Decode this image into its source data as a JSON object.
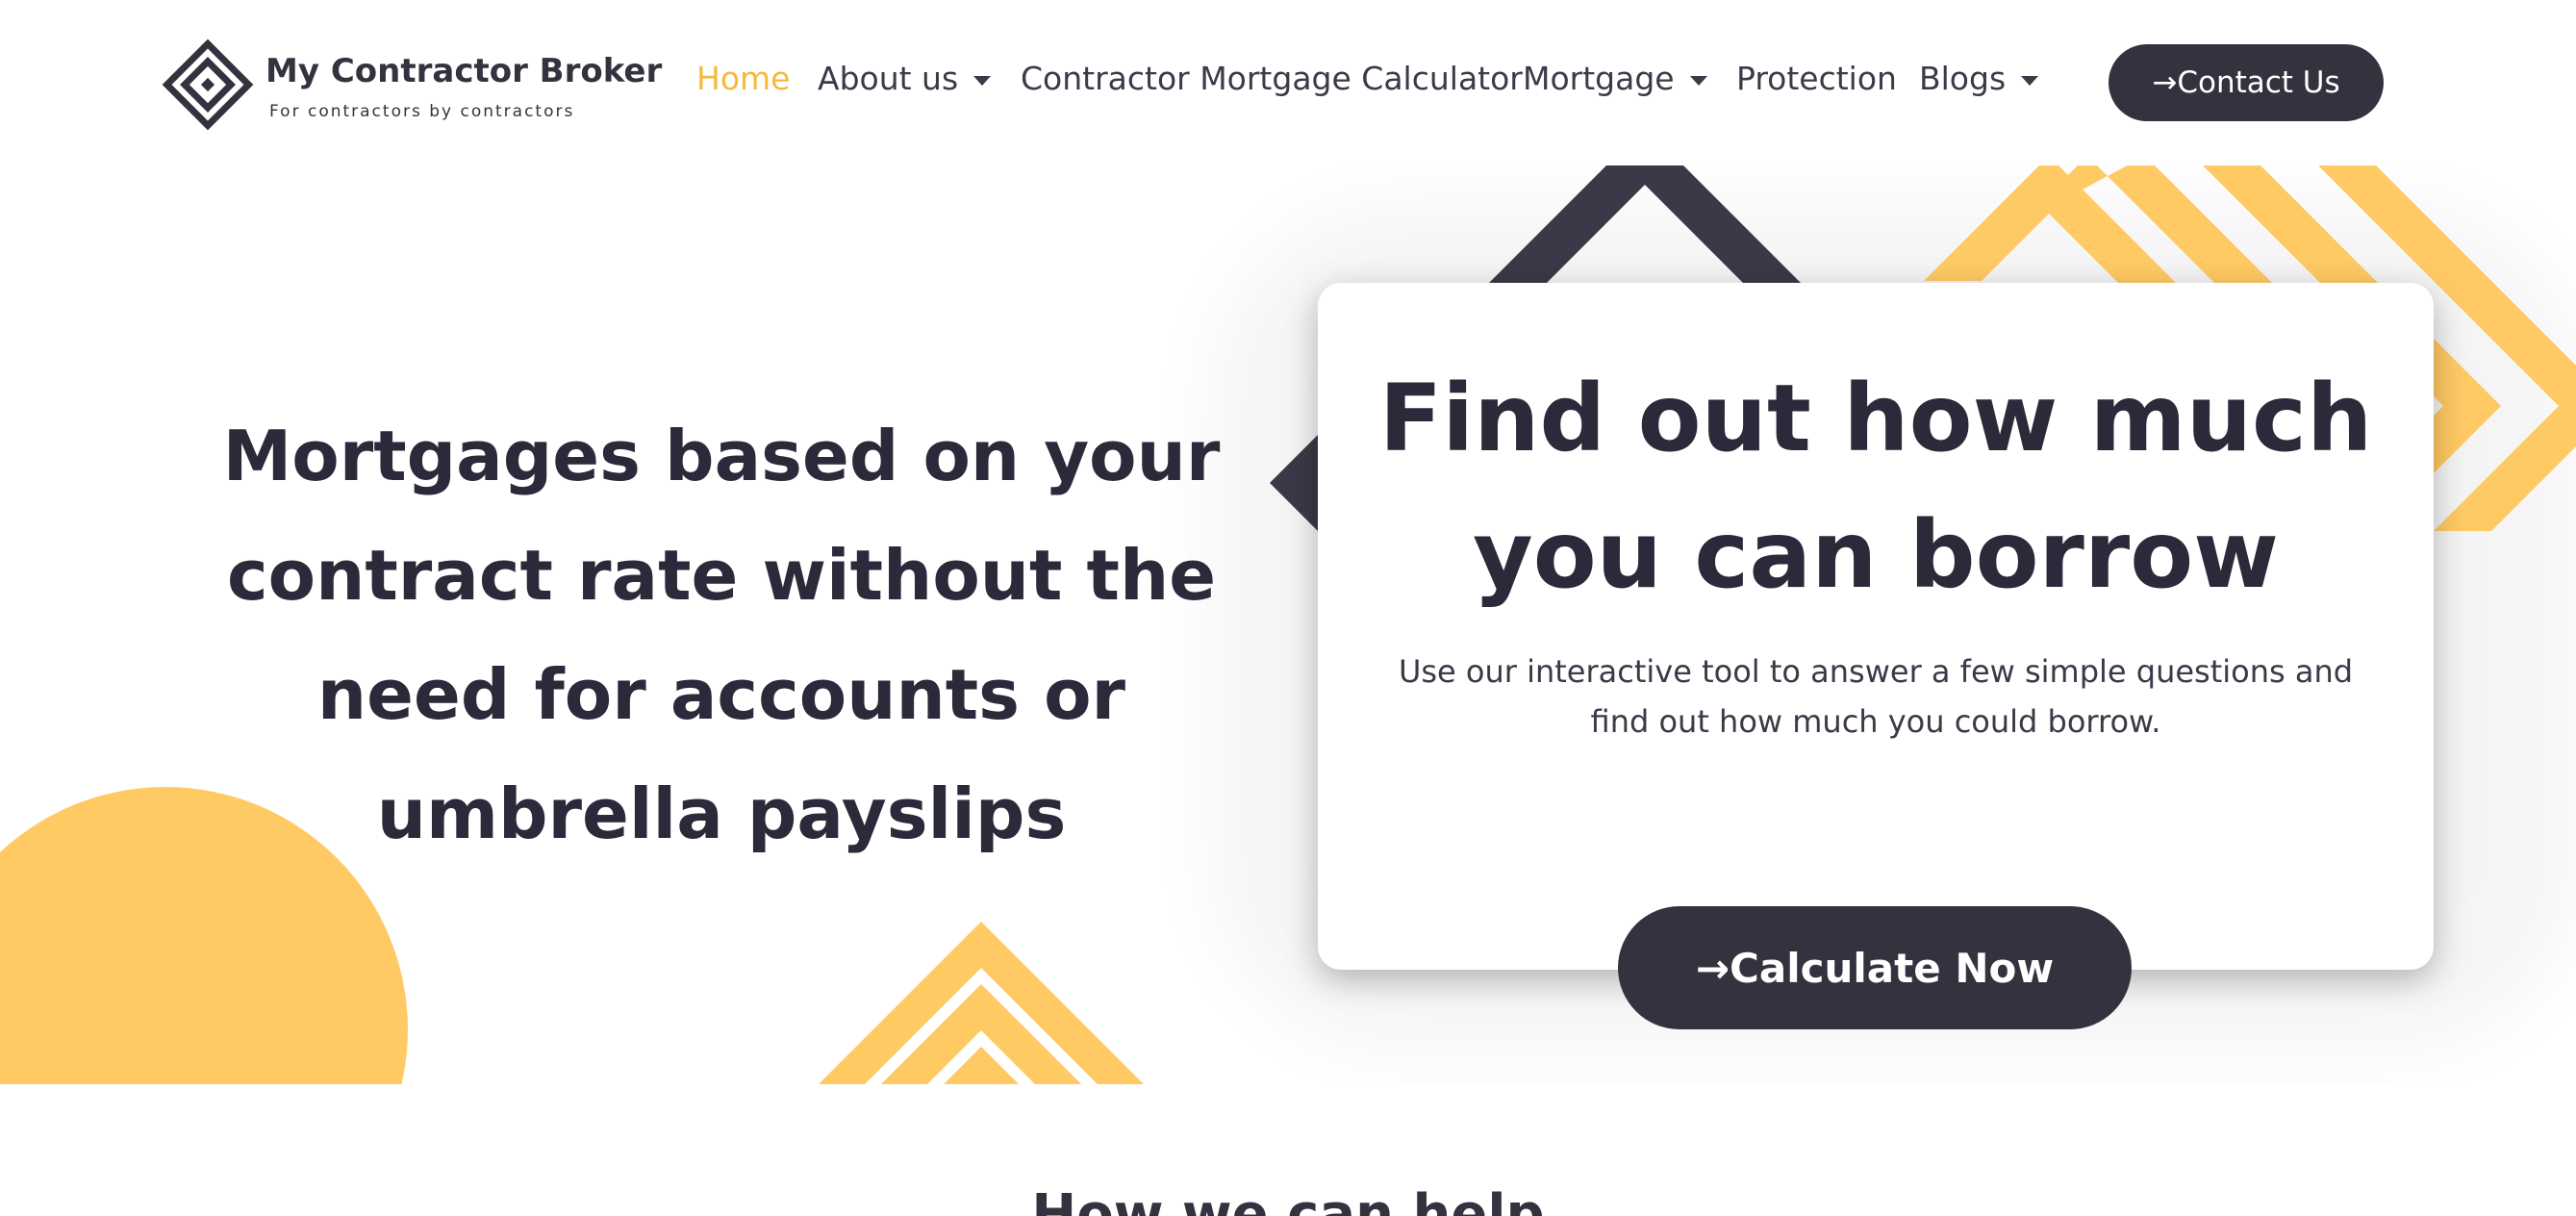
{
  "colors": {
    "accent_yellow": "#f5b93b",
    "shape_yellow": "#ffca64",
    "dark": "#34323f",
    "text": "#2a2a3a",
    "background": "#ffffff"
  },
  "logo": {
    "icon": "diamond-logo-icon",
    "name": "My Contractor Broker",
    "tagline": "For contractors by contractors"
  },
  "nav": {
    "items": [
      {
        "label": "Home",
        "active": true,
        "dropdown": false
      },
      {
        "label": "About us",
        "active": false,
        "dropdown": true
      },
      {
        "label": "Contractor Mortgage Calculator",
        "active": false,
        "dropdown": false
      },
      {
        "label": "Mortgage",
        "active": false,
        "dropdown": true
      },
      {
        "label": "Protection",
        "active": false,
        "dropdown": false
      },
      {
        "label": "Blogs",
        "active": false,
        "dropdown": true
      }
    ],
    "contact_label": "→Contact Us"
  },
  "hero": {
    "heading_lines": [
      "Mortgages based on your",
      "contract rate without the",
      "need for accounts or",
      "umbrella payslips"
    ]
  },
  "card": {
    "title_lines": [
      "Find out how much",
      "you can borrow"
    ],
    "text_lines": [
      "Use our interactive tool to answer a few simple questions and",
      "find out how much you could borrow."
    ],
    "button_label": "→Calculate Now"
  },
  "next_section": {
    "title": "How we can help"
  }
}
